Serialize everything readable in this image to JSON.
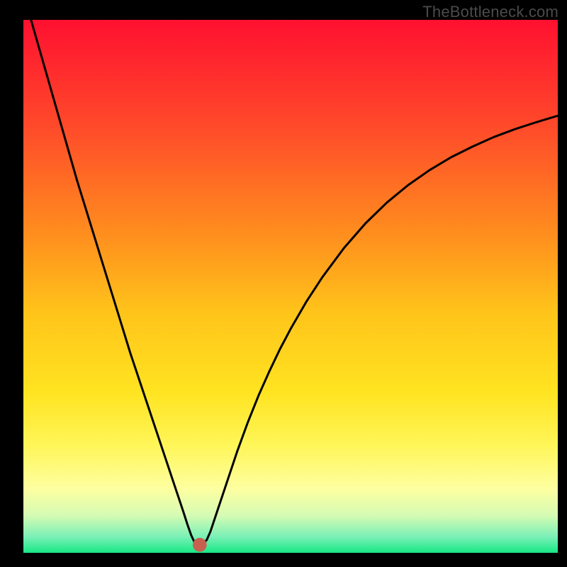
{
  "watermark": "TheBottleneck.com",
  "chart_data": {
    "type": "line",
    "title": "",
    "xlabel": "",
    "ylabel": "",
    "xlim": [
      0,
      100
    ],
    "ylim": [
      0,
      100
    ],
    "grid": false,
    "legend": false,
    "background": {
      "type": "vertical-gradient",
      "stops": [
        {
          "pos": 0.0,
          "color": "#ff1030"
        },
        {
          "pos": 0.2,
          "color": "#ff4a2a"
        },
        {
          "pos": 0.4,
          "color": "#ff8d1e"
        },
        {
          "pos": 0.55,
          "color": "#ffc41a"
        },
        {
          "pos": 0.7,
          "color": "#ffe421"
        },
        {
          "pos": 0.8,
          "color": "#fff65a"
        },
        {
          "pos": 0.88,
          "color": "#fdffa0"
        },
        {
          "pos": 0.93,
          "color": "#d5fbb4"
        },
        {
          "pos": 0.97,
          "color": "#7af0b6"
        },
        {
          "pos": 1.0,
          "color": "#17e884"
        }
      ]
    },
    "marker": {
      "x": 33,
      "y": 1.5,
      "color": "#c7604e",
      "r": 1.3
    },
    "series": [
      {
        "name": "bottleneck-curve",
        "color": "#000000",
        "x": [
          0,
          2,
          4,
          6,
          8,
          10,
          12,
          14,
          16,
          18,
          20,
          22,
          24,
          26,
          28,
          29,
          30,
          30.7,
          31.4,
          32.1,
          32.8,
          33.5,
          34.3,
          35,
          36,
          37,
          38,
          39,
          40,
          42,
          44,
          46,
          48,
          50,
          53,
          56,
          60,
          64,
          68,
          72,
          76,
          80,
          84,
          88,
          92,
          96,
          100
        ],
        "values": [
          105,
          98,
          91,
          84,
          77,
          70,
          63.5,
          57,
          50.5,
          44,
          37.5,
          31.5,
          25.5,
          19.5,
          13.5,
          10.5,
          7.5,
          5.3,
          3.3,
          1.8,
          1.6,
          1.7,
          2.4,
          4.0,
          7.0,
          10.0,
          13.0,
          16.0,
          19.0,
          24.5,
          29.5,
          34.0,
          38.2,
          42.0,
          47.2,
          51.8,
          57.2,
          61.8,
          65.7,
          69.0,
          71.8,
          74.2,
          76.2,
          78.0,
          79.5,
          80.8,
          82.0
        ]
      }
    ]
  }
}
